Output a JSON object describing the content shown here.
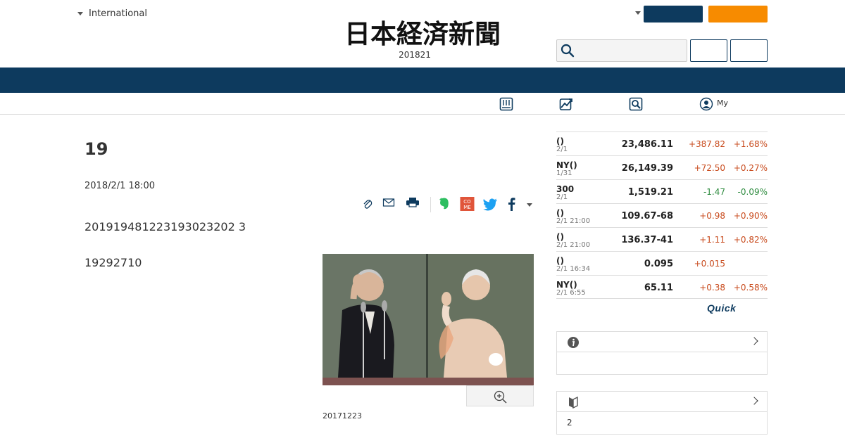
{
  "header": {
    "edition_label": "International",
    "logo_text": "日本経済新聞",
    "date_text": "201821",
    "accent_navy": "#0d3a5e",
    "accent_orange": "#f78b00"
  },
  "subnav": {
    "my_label": "My"
  },
  "article": {
    "title": "19",
    "date": "2018/2/1 18:00",
    "paragraph1": "201919481223193023202 3",
    "paragraph2": "19292710",
    "caption": "20171223"
  },
  "market": {
    "rows": [
      {
        "name": "()",
        "time": "2/1",
        "value": "23,486.11",
        "change": "+387.82",
        "pct": "+1.68%",
        "dir": "up"
      },
      {
        "name": "NY()",
        "time": "1/31",
        "value": "26,149.39",
        "change": "+72.50",
        "pct": "+0.27%",
        "dir": "up"
      },
      {
        "name": "300",
        "time": "2/1",
        "value": "1,519.21",
        "change": "-1.47",
        "pct": "-0.09%",
        "dir": "down"
      },
      {
        "name": "()",
        "time": "2/1 21:00",
        "value": "109.67-68",
        "change": "+0.98",
        "pct": "+0.90%",
        "dir": "up"
      },
      {
        "name": "()",
        "time": "2/1 21:00",
        "value": "136.37-41",
        "change": "+1.11",
        "pct": "+0.82%",
        "dir": "up"
      },
      {
        "name": "()",
        "time": "2/1 16:34",
        "value": "0.095",
        "change": "+0.015",
        "pct": "",
        "dir": "up"
      },
      {
        "name": "NY()",
        "time": "2/1 6:55",
        "value": "65.11",
        "change": "+0.38",
        "pct": "+0.58%",
        "dir": "up"
      }
    ],
    "provider": "Quick"
  },
  "side_boxes": {
    "box2_text": "2"
  }
}
